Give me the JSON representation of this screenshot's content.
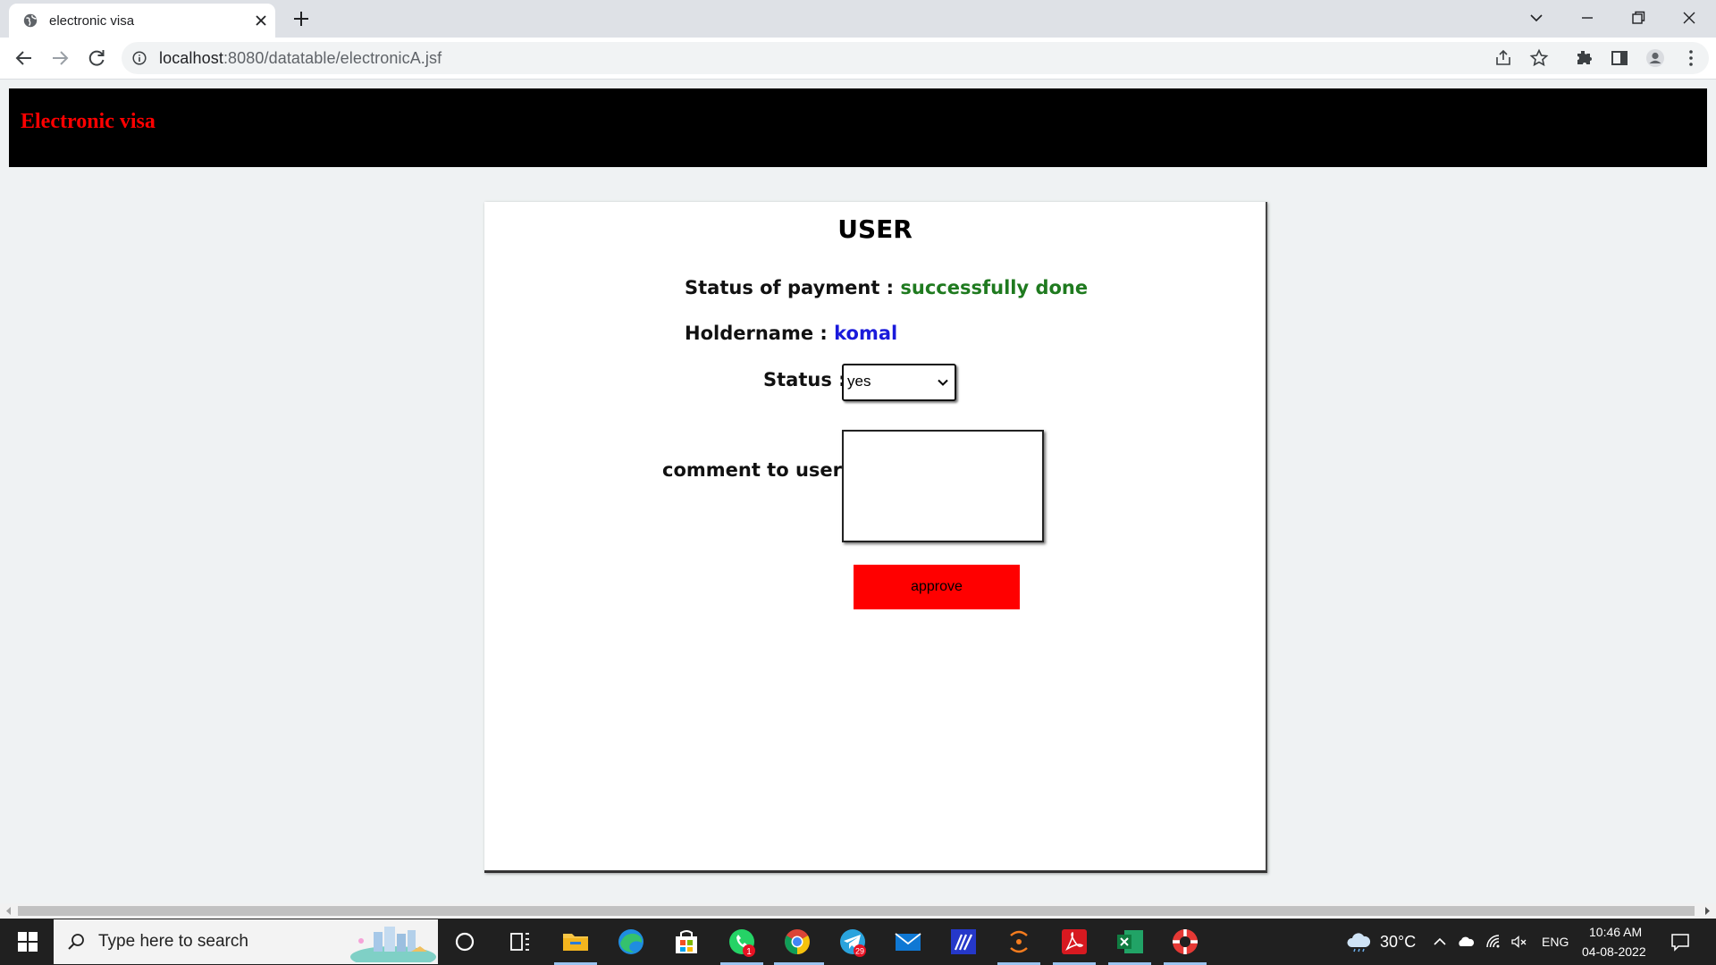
{
  "browser": {
    "tab_title": "electronic visa",
    "url_host": "localhost",
    "url_path": ":8080/datatable/electronicA.jsf"
  },
  "header": {
    "title": "Electronic visa"
  },
  "card": {
    "title": "USER",
    "payment_label": "Status of payment :",
    "payment_value": "successfully done",
    "holder_label": "Holdername :",
    "holder_value": "komal",
    "status_label": "Status :",
    "status_value": "yes",
    "comment_label": "comment to user :",
    "comment_value": "",
    "approve_label": "approve"
  },
  "taskbar": {
    "search_placeholder": "Type here to search",
    "whatsapp_badge": "1",
    "telegram_badge": "29",
    "temperature": "30°C",
    "language": "ENG",
    "time": "10:46 AM",
    "date": "04-08-2022"
  },
  "colors": {
    "header_bg": "#000000",
    "header_title": "#ff0000",
    "payment_value": "#1f7a1f",
    "holder_value": "#1a1adb",
    "approve_button": "#ff0000"
  }
}
